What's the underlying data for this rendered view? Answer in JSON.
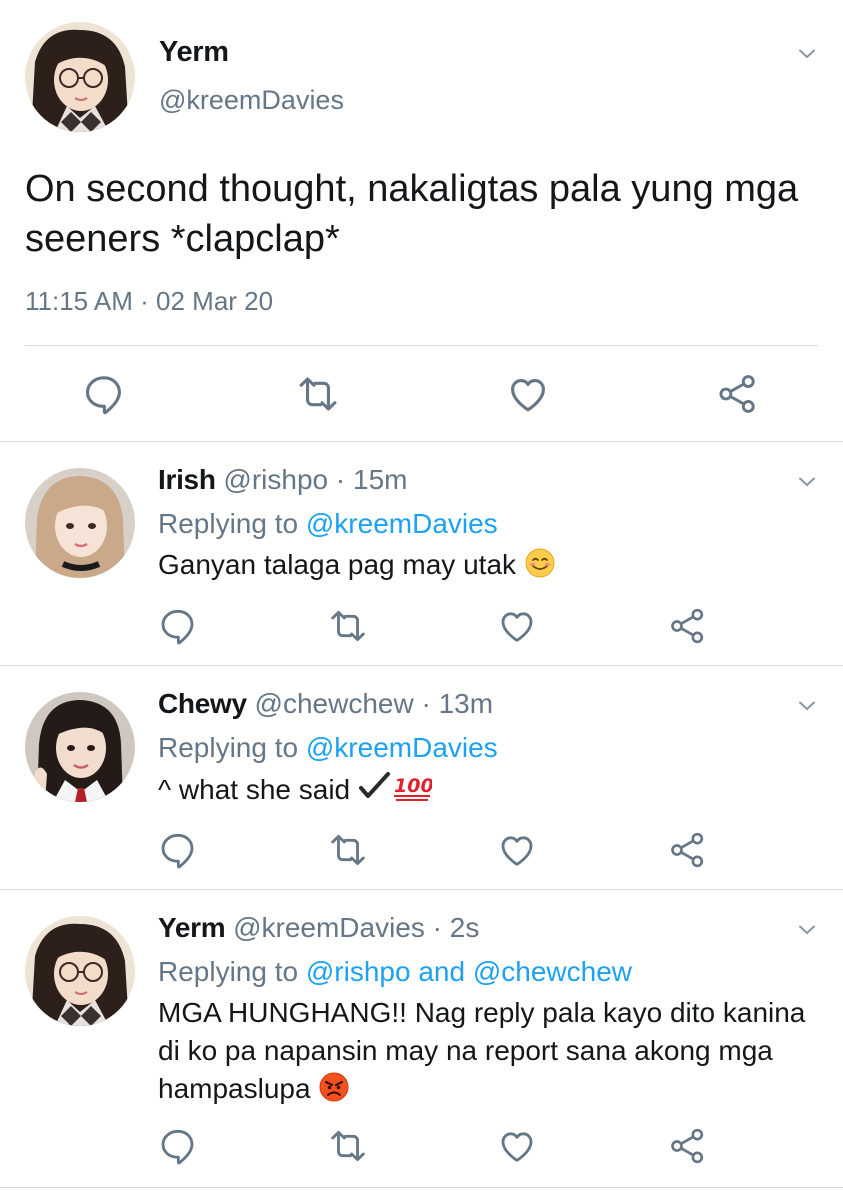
{
  "main_tweet": {
    "name": "Yerm",
    "handle": "@kreemDavies",
    "text": "On second thought, nakaligtas pala yung mga seeners *clapclap*",
    "timestamp": "11:15 AM · 02 Mar 20"
  },
  "replies": [
    {
      "name": "Irish",
      "meta": "@rishpo · 15m",
      "replying_prefix": "Replying to ",
      "replying_to": "@kreemDavies",
      "text": "Ganyan talaga pag may utak ",
      "emoji": "smiling-face-emoji"
    },
    {
      "name": "Chewy",
      "meta": "@chewchew · 13m",
      "replying_prefix": "Replying to ",
      "replying_to": "@kreemDavies",
      "text": "^ what she said ",
      "emoji": "check-100-emoji",
      "emoji_text": "100"
    },
    {
      "name": "Yerm",
      "meta": "@kreemDavies · 2s",
      "replying_prefix": "Replying to ",
      "replying_to": "@rishpo and @chewchew",
      "text": "MGA HUNGHANG!! Nag reply pala kayo dito kanina di ko pa napansin may na report sana akong mga hampaslupa ",
      "emoji": "angry-face-emoji"
    }
  ],
  "colors": {
    "text": "#14171a",
    "secondary": "#657786",
    "link": "#1da1f2",
    "divider": "#d6dbdf",
    "icon": "#657786"
  },
  "icons": [
    "chevron-down-icon",
    "reply-icon",
    "retweet-icon",
    "like-icon",
    "share-icon"
  ]
}
